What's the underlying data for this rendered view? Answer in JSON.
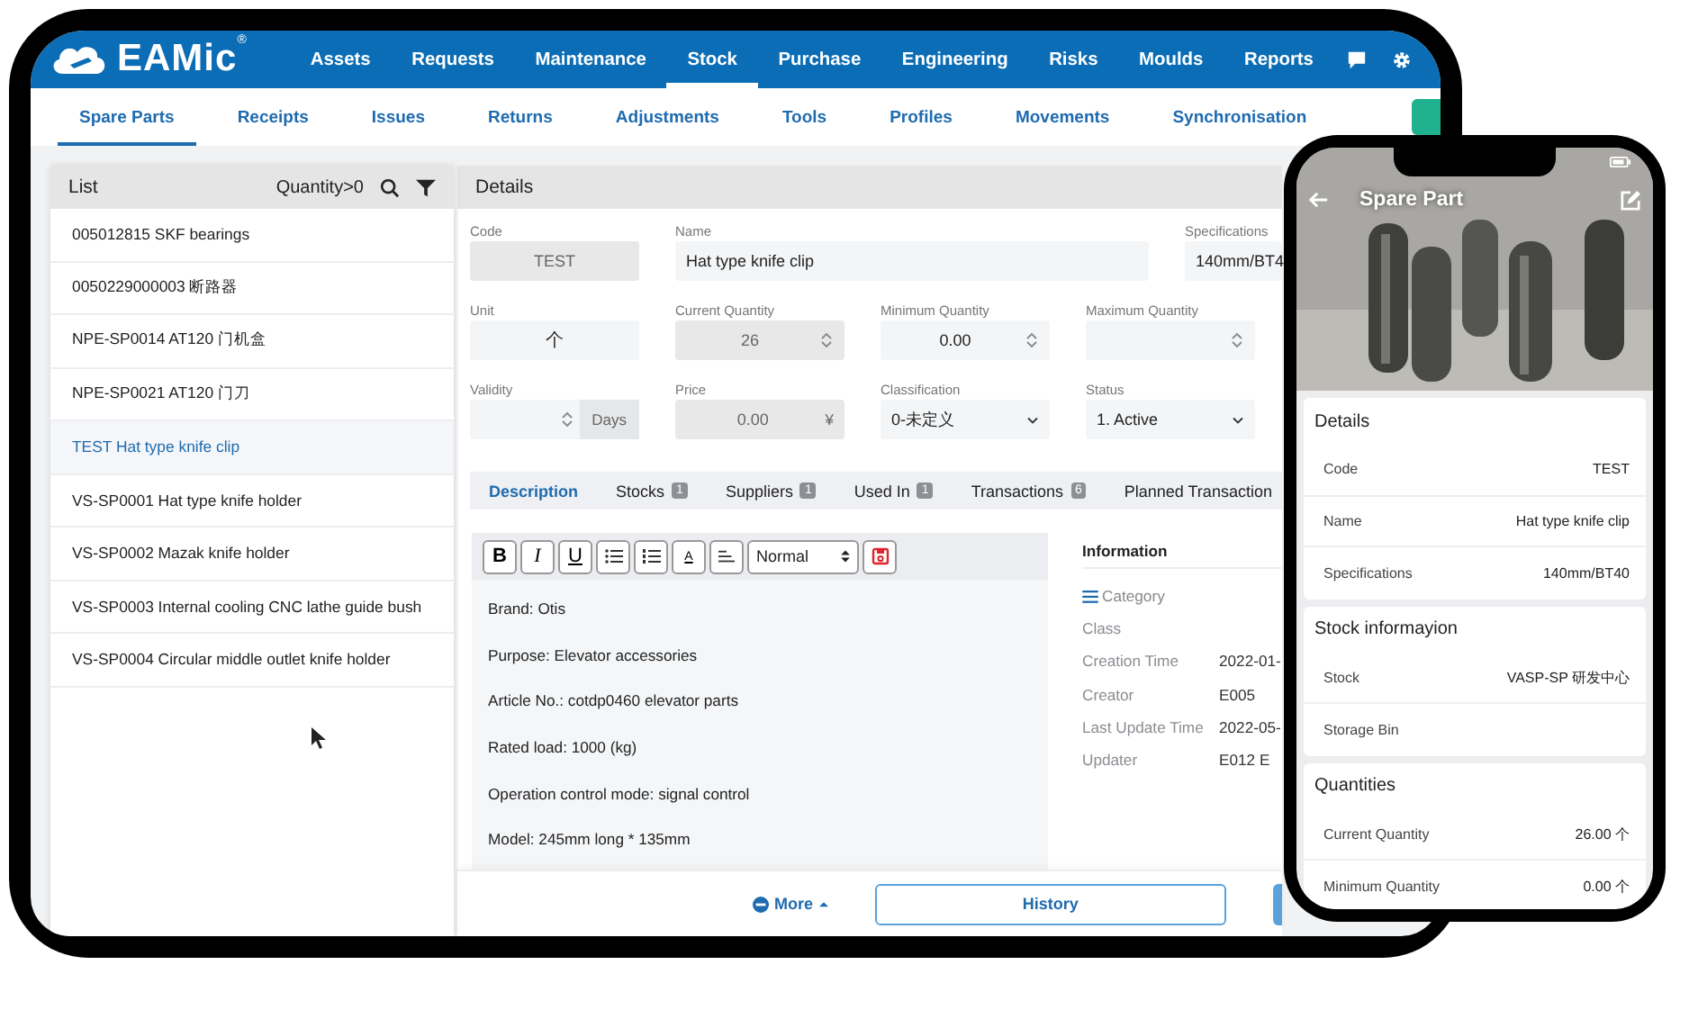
{
  "brand": {
    "name": "EAMic",
    "mark": "®"
  },
  "nav": [
    {
      "label": "Assets",
      "selected": false
    },
    {
      "label": "Requests",
      "selected": false
    },
    {
      "label": "Maintenance",
      "selected": false
    },
    {
      "label": "Stock",
      "selected": true
    },
    {
      "label": "Purchase",
      "selected": false
    },
    {
      "label": "Engineering",
      "selected": false
    },
    {
      "label": "Risks",
      "selected": false
    },
    {
      "label": "Moulds",
      "selected": false
    },
    {
      "label": "Reports",
      "selected": false
    }
  ],
  "subnav": [
    {
      "label": "Spare Parts",
      "selected": true
    },
    {
      "label": "Receipts",
      "selected": false
    },
    {
      "label": "Issues",
      "selected": false
    },
    {
      "label": "Returns",
      "selected": false
    },
    {
      "label": "Adjustments",
      "selected": false
    },
    {
      "label": "Tools",
      "selected": false
    },
    {
      "label": "Profiles",
      "selected": false
    },
    {
      "label": "Movements",
      "selected": false
    },
    {
      "label": "Synchronisation",
      "selected": false
    }
  ],
  "list": {
    "title": "List",
    "filter": "Quantity>0",
    "items": [
      {
        "label": "005012815 SKF bearings",
        "selected": false
      },
      {
        "label": "0050229000003 断路器",
        "selected": false
      },
      {
        "label": "NPE-SP0014 AT120 门机盒",
        "selected": false
      },
      {
        "label": "NPE-SP0021 AT120 门刀",
        "selected": false
      },
      {
        "label": "TEST Hat type knife clip",
        "selected": true
      },
      {
        "label": "VS-SP0001 Hat type knife holder",
        "selected": false
      },
      {
        "label": "VS-SP0002 Mazak knife holder",
        "selected": false
      },
      {
        "label": "VS-SP0003 Internal cooling CNC lathe guide bush",
        "selected": false
      },
      {
        "label": "VS-SP0004 Circular middle outlet knife holder",
        "selected": false
      }
    ]
  },
  "details": {
    "title": "Details",
    "rows": [
      {
        "fields": [
          {
            "label": "Code",
            "value": "TEST",
            "kind": "text",
            "disabled": true
          },
          {
            "label": "Name",
            "value": "Hat type knife clip",
            "kind": "text",
            "disabled": false,
            "wide": true
          },
          {
            "label": "Specifications",
            "value": "140mm/BT4",
            "kind": "text",
            "disabled": false
          }
        ]
      },
      {
        "fields": [
          {
            "label": "Unit",
            "value": "个",
            "kind": "unit",
            "disabled": false
          },
          {
            "label": "Current Quantity",
            "value": "26",
            "kind": "number",
            "disabled": true
          },
          {
            "label": "Minimum Quantity",
            "value": "0.00",
            "kind": "number",
            "disabled": false
          },
          {
            "label": "Maximum Quantity",
            "kind": "number",
            "disabled": false
          }
        ]
      },
      {
        "fields": [
          {
            "label": "Validity",
            "kind": "number",
            "disabled": false,
            "suffix": "Days"
          },
          {
            "label": "Price",
            "value": "0.00",
            "kind": "currency",
            "disabled": true,
            "suffix": "¥"
          },
          {
            "label": "Classification",
            "value": "0-未定义",
            "kind": "select",
            "disabled": false
          },
          {
            "label": "Status",
            "value": "1. Active",
            "kind": "select",
            "disabled": false
          }
        ]
      }
    ],
    "tabs": [
      {
        "label": "Description",
        "selected": true
      },
      {
        "label": "Stocks",
        "count": "1",
        "selected": false
      },
      {
        "label": "Suppliers",
        "count": "1",
        "selected": false
      },
      {
        "label": "Used In",
        "count": "1",
        "selected": false
      },
      {
        "label": "Transactions",
        "count": "6",
        "selected": false
      },
      {
        "label": "Planned Transaction",
        "selected": false
      }
    ],
    "toolbar": [
      {
        "kind": "bold",
        "label": "B"
      },
      {
        "kind": "italic",
        "label": "I"
      },
      {
        "kind": "underline",
        "label": "U"
      },
      {
        "kind": "bullets"
      },
      {
        "kind": "numbers"
      },
      {
        "kind": "color",
        "label": "A"
      },
      {
        "kind": "align"
      }
    ],
    "format": "Normal",
    "description": [
      "Brand: Otis",
      "Purpose: Elevator accessories",
      "Article No.: cotdp0460 elevator parts",
      "Rated load: 1000 (kg)",
      "Operation control mode: signal control",
      "Model: 245mm long * 135mm"
    ],
    "information": {
      "title": "Information",
      "category": "Category",
      "rows": [
        {
          "label": "Class"
        },
        {
          "label": "Creation Time",
          "value": "2022-01-"
        },
        {
          "label": "Creator",
          "value": "E005"
        },
        {
          "label": "Last Update Time",
          "value": "2022-05-"
        },
        {
          "label": "Updater",
          "value": "E012 E"
        }
      ]
    },
    "more": "More",
    "history": "History"
  },
  "phone": {
    "title": "Spare Part",
    "sections": [
      {
        "title": "Details",
        "rows": [
          {
            "label": "Code",
            "value": "TEST"
          },
          {
            "label": "Name",
            "value": "Hat type knife clip"
          },
          {
            "label": "Specifications",
            "value": "140mm/BT40"
          }
        ]
      },
      {
        "title": "Stock informayion",
        "rows": [
          {
            "label": "Stock",
            "value": "VASP-SP 研发中心"
          },
          {
            "label": "Storage Bin"
          }
        ]
      },
      {
        "title": "Quantities",
        "rows": [
          {
            "label": "Current Quantity",
            "value": "26.00 个"
          },
          {
            "label": "Minimum Quantity",
            "value": "0.00 个"
          }
        ]
      }
    ]
  }
}
